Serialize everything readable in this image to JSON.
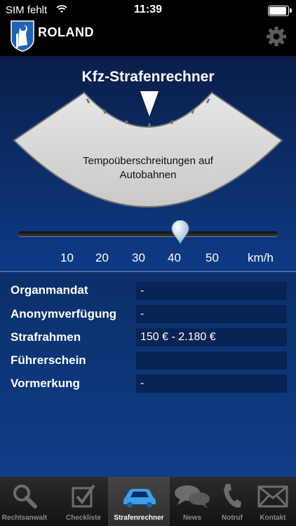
{
  "status_bar": {
    "carrier": "SIM fehlt",
    "time": "11:39",
    "battery_level": 0.95
  },
  "navbar": {
    "brand": "ROLAND",
    "logo_icon": "roland-knight-logo",
    "settings_icon": "gear-icon"
  },
  "gauge": {
    "title": "Kfz-Strafenrechner",
    "category": "Tempoüberschreitungen auf Autobahnen",
    "pointer_icon": "triangle-down-icon"
  },
  "slider": {
    "ticks": [
      "10",
      "20",
      "30",
      "40",
      "50"
    ],
    "unit": "km/h",
    "value": 40
  },
  "results": {
    "rows": [
      {
        "label": "Organmandat",
        "value": "-"
      },
      {
        "label": "Anonymverfügung",
        "value": "-"
      },
      {
        "label": "Strafrahmen",
        "value": "150 € - 2.180 €"
      },
      {
        "label": "Führerschein",
        "value": ""
      },
      {
        "label": "Vormerkung",
        "value": "-"
      }
    ]
  },
  "tabs": [
    {
      "label": "Rechtsanwalt",
      "icon": "magnifier-icon",
      "active": false
    },
    {
      "label": "Checkliste",
      "icon": "checkbox-icon",
      "active": false
    },
    {
      "label": "Strafenrechner",
      "icon": "car-icon",
      "active": true
    },
    {
      "label": "News",
      "icon": "speech-bubbles-icon",
      "active": false
    },
    {
      "label": "Notruf",
      "icon": "phone-icon",
      "active": false
    },
    {
      "label": "Kontakt",
      "icon": "envelope-icon",
      "active": false
    }
  ],
  "colors": {
    "background": "#0b2a66",
    "accent": "#3aa0e8",
    "dial": "#d8d8d8"
  }
}
